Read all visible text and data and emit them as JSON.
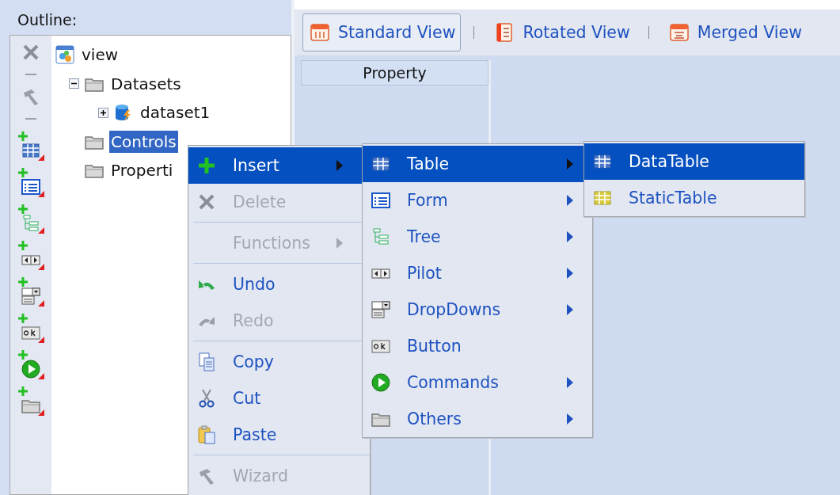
{
  "outline": {
    "title": "Outline:",
    "tree": [
      {
        "label": "view",
        "kind": "view",
        "selected": false,
        "children": [
          {
            "label": "Datasets",
            "kind": "folder",
            "selected": false,
            "expanded": true,
            "children": [
              {
                "label": "dataset1",
                "kind": "dataset",
                "selected": false,
                "expanded": false
              }
            ]
          },
          {
            "label": "Controls",
            "kind": "folder",
            "selected": true
          },
          {
            "label": "Properti",
            "kind": "folder",
            "selected": false
          }
        ]
      }
    ]
  },
  "view_tabs": [
    {
      "label": "Standard View",
      "selected": true
    },
    {
      "label": "Rotated View",
      "selected": false
    },
    {
      "label": "Merged View",
      "selected": false
    }
  ],
  "table": {
    "columns": [
      "Property"
    ]
  },
  "menus": [
    {
      "items": [
        {
          "kind": "item",
          "label": "Insert",
          "selected": true,
          "disabled": false,
          "has_submenu": true
        },
        {
          "kind": "item",
          "label": "Delete",
          "selected": false,
          "disabled": true,
          "has_submenu": false
        },
        {
          "kind": "separator"
        },
        {
          "kind": "item",
          "label": "Functions",
          "selected": false,
          "disabled": true,
          "has_submenu": true
        },
        {
          "kind": "separator"
        },
        {
          "kind": "item",
          "label": "Undo",
          "selected": false,
          "disabled": false,
          "has_submenu": false
        },
        {
          "kind": "item",
          "label": "Redo",
          "selected": false,
          "disabled": true,
          "has_submenu": false
        },
        {
          "kind": "separator"
        },
        {
          "kind": "item",
          "label": "Copy",
          "selected": false,
          "disabled": false,
          "has_submenu": false
        },
        {
          "kind": "item",
          "label": "Cut",
          "selected": false,
          "disabled": false,
          "has_submenu": false
        },
        {
          "kind": "item",
          "label": "Paste",
          "selected": false,
          "disabled": false,
          "has_submenu": false
        },
        {
          "kind": "separator"
        },
        {
          "kind": "item",
          "label": "Wizard",
          "selected": false,
          "disabled": true,
          "has_submenu": false
        }
      ]
    },
    {
      "items": [
        {
          "kind": "item",
          "label": "Table",
          "selected": true,
          "disabled": false,
          "has_submenu": true
        },
        {
          "kind": "item",
          "label": "Form",
          "selected": false,
          "disabled": false,
          "has_submenu": true
        },
        {
          "kind": "item",
          "label": "Tree",
          "selected": false,
          "disabled": false,
          "has_submenu": true
        },
        {
          "kind": "item",
          "label": "Pilot",
          "selected": false,
          "disabled": false,
          "has_submenu": true
        },
        {
          "kind": "item",
          "label": "DropDowns",
          "selected": false,
          "disabled": false,
          "has_submenu": true
        },
        {
          "kind": "item",
          "label": "Button",
          "selected": false,
          "disabled": false,
          "has_submenu": false
        },
        {
          "kind": "item",
          "label": "Commands",
          "selected": false,
          "disabled": false,
          "has_submenu": true
        },
        {
          "kind": "item",
          "label": "Others",
          "selected": false,
          "disabled": false,
          "has_submenu": true
        }
      ]
    },
    {
      "items": [
        {
          "kind": "item",
          "label": "DataTable",
          "selected": true,
          "disabled": false,
          "has_submenu": false
        },
        {
          "kind": "item",
          "label": "StaticTable",
          "selected": false,
          "disabled": false,
          "has_submenu": false
        }
      ]
    }
  ]
}
